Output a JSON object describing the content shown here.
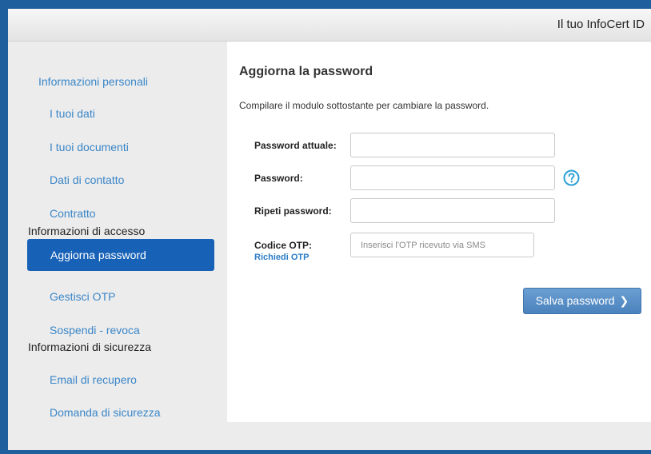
{
  "header": {
    "title": "Il tuo InfoCert ID"
  },
  "sidebar": {
    "personal_heading": "Informazioni personali",
    "personal_items": [
      "I tuoi dati",
      "I tuoi documenti",
      "Dati di contatto",
      "Contratto"
    ],
    "access_heading": "Informazioni di accesso",
    "access_items": [
      "Aggiorna password",
      "Gestisci OTP",
      "Sospendi - revoca"
    ],
    "security_heading": "Informazioni di sicurezza",
    "security_items": [
      "Email di recupero",
      "Domanda di sicurezza"
    ],
    "active_item": "Aggiorna password"
  },
  "main": {
    "title": "Aggiorna la password",
    "intro": "Compilare il modulo sottostante per cambiare la password.",
    "form": {
      "current_password_label": "Password attuale:",
      "current_password_value": "",
      "password_label": "Password:",
      "password_value": "",
      "repeat_password_label": "Ripeti password:",
      "repeat_password_value": "",
      "otp_label": "Codice OTP:",
      "otp_value": "",
      "otp_placeholder": "Inserisci l'OTP ricevuto via SMS",
      "request_otp_link": "Richiedi OTP"
    },
    "save_button_label": "Salva password",
    "help_icon": "question-circle-icon",
    "save_icon": "chevron-right-icon"
  },
  "colors": {
    "frame_border": "#1f5f9e",
    "nav_link": "#3a86c8",
    "nav_active_bg": "#1761b7",
    "button_bg": "#5a90c8",
    "help_icon": "#2aa1d8"
  }
}
